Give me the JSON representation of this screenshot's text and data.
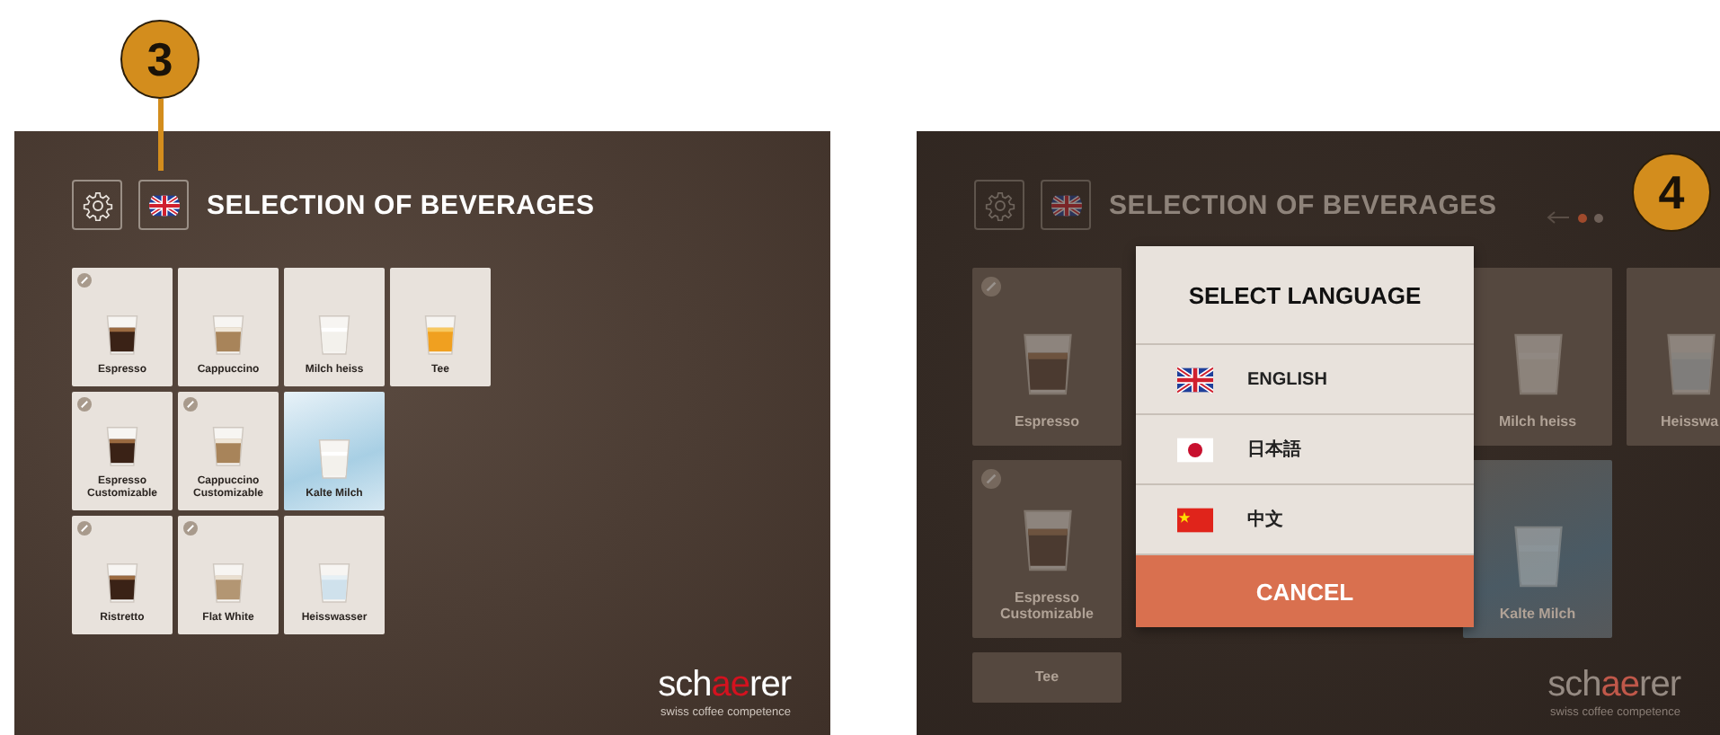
{
  "screens": [
    {
      "callout": "3",
      "dimmed": false,
      "title": "SELECTION OF BEVERAGES",
      "pager": false,
      "rows": [
        {
          "left": [
            {
              "label": "Espresso",
              "kind": "espresso",
              "editable": true,
              "iced": false
            },
            {
              "label": "Cappuccino",
              "kind": "cappuccino",
              "editable": false,
              "iced": false
            },
            {
              "label": "Milch heiss",
              "kind": "milk",
              "editable": false,
              "iced": false
            },
            {
              "label": "Tee",
              "kind": "tea",
              "editable": false,
              "iced": false
            }
          ],
          "right": []
        },
        {
          "left": [
            {
              "label": "Espresso Customizable",
              "kind": "espresso",
              "editable": true,
              "iced": false
            },
            {
              "label": "Cappuccino Customizable",
              "kind": "cappuccino",
              "editable": true,
              "iced": false
            },
            {
              "label": "Kalte Milch",
              "kind": "milk",
              "editable": false,
              "iced": true
            }
          ],
          "right": []
        },
        {
          "left": [
            {
              "label": "Ristretto",
              "kind": "espresso",
              "editable": true,
              "iced": false
            },
            {
              "label": "Flat White",
              "kind": "flatwhite",
              "editable": true,
              "iced": false
            },
            {
              "label": "Heisswasser",
              "kind": "water",
              "editable": false,
              "iced": false
            }
          ],
          "right": []
        }
      ],
      "logo": {
        "before": "sch",
        "accent": "ae",
        "after": "rer",
        "tagline": "swiss coffee competence"
      }
    },
    {
      "callout": "4",
      "dimmed": true,
      "title": "SELECTION OF BEVERAGES",
      "pager": true,
      "rows": [
        {
          "left": [
            {
              "label": "Espresso",
              "kind": "espresso",
              "editable": true,
              "iced": false
            }
          ],
          "right": [
            {
              "label": "Milch heiss",
              "kind": "milk",
              "editable": false,
              "iced": false
            },
            {
              "label": "Heisswa",
              "kind": "water",
              "editable": false,
              "iced": false,
              "clipped": true
            }
          ]
        },
        {
          "left": [
            {
              "label": "Espresso Customizable",
              "kind": "espresso",
              "editable": true,
              "iced": false
            }
          ],
          "right": [
            {
              "label": "Kalte Milch",
              "kind": "milk",
              "editable": false,
              "iced": true
            }
          ]
        },
        {
          "left": [
            {
              "label": "Tee",
              "kind": "text",
              "editable": false,
              "iced": false
            }
          ],
          "right": []
        }
      ],
      "logo": {
        "before": "sch",
        "accent": "ae",
        "after": "rer",
        "tagline": "swiss coffee competence"
      },
      "dialog": {
        "title": "SELECT LANGUAGE",
        "languages": [
          {
            "kind": "uk",
            "label": "ENGLISH"
          },
          {
            "kind": "japan",
            "label": "日本語"
          },
          {
            "kind": "china",
            "label": "中文"
          }
        ],
        "cancel": "CANCEL"
      }
    }
  ]
}
